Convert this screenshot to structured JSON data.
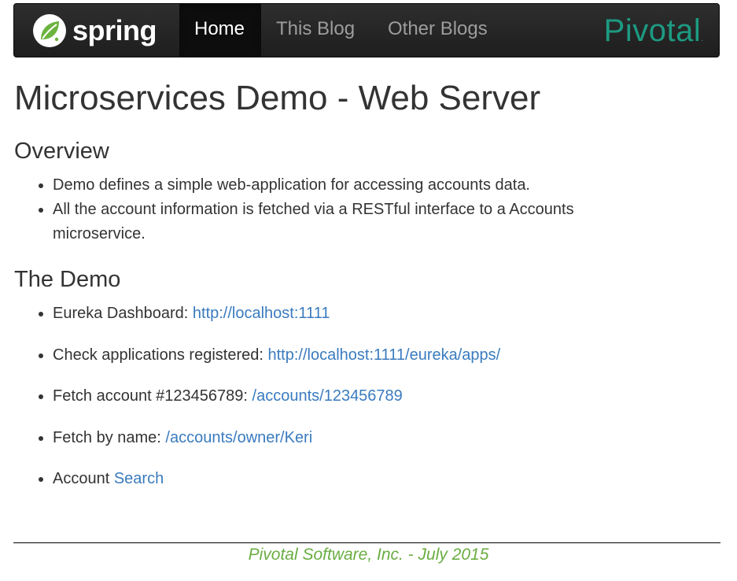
{
  "navbar": {
    "brand": "spring",
    "items": [
      {
        "label": "Home",
        "active": true
      },
      {
        "label": "This Blog"
      },
      {
        "label": "Other Blogs"
      }
    ],
    "partner_logo": "Pivotal",
    "partner_logo_mark": ".",
    "colors": {
      "background": "#222222",
      "active": "#0d0d0d",
      "spring_green": "#6db33f",
      "pivotal_teal": "#1d9a82"
    }
  },
  "page": {
    "title": "Microservices Demo - Web Server",
    "overview": {
      "heading": "Overview",
      "items": [
        "Demo defines a simple web-application for accessing accounts data.",
        "All the account information is fetched via a RESTful interface to a Accounts microservice."
      ]
    },
    "demo": {
      "heading": "The Demo",
      "items": [
        {
          "text": "Eureka Dashboard: ",
          "link": "http://localhost:1111"
        },
        {
          "text": "Check applications registered: ",
          "link": "http://localhost:1111/eureka/apps/"
        },
        {
          "text": "Fetch account #123456789: ",
          "link": "/accounts/123456789"
        },
        {
          "text": "Fetch by name: ",
          "link": "/accounts/owner/Keri"
        },
        {
          "text": "Account ",
          "link": "Search"
        }
      ]
    }
  },
  "footer": {
    "text": "Pivotal Software, Inc. - July 2015",
    "color": "#6aad42"
  },
  "link_color": "#3a7bbf"
}
